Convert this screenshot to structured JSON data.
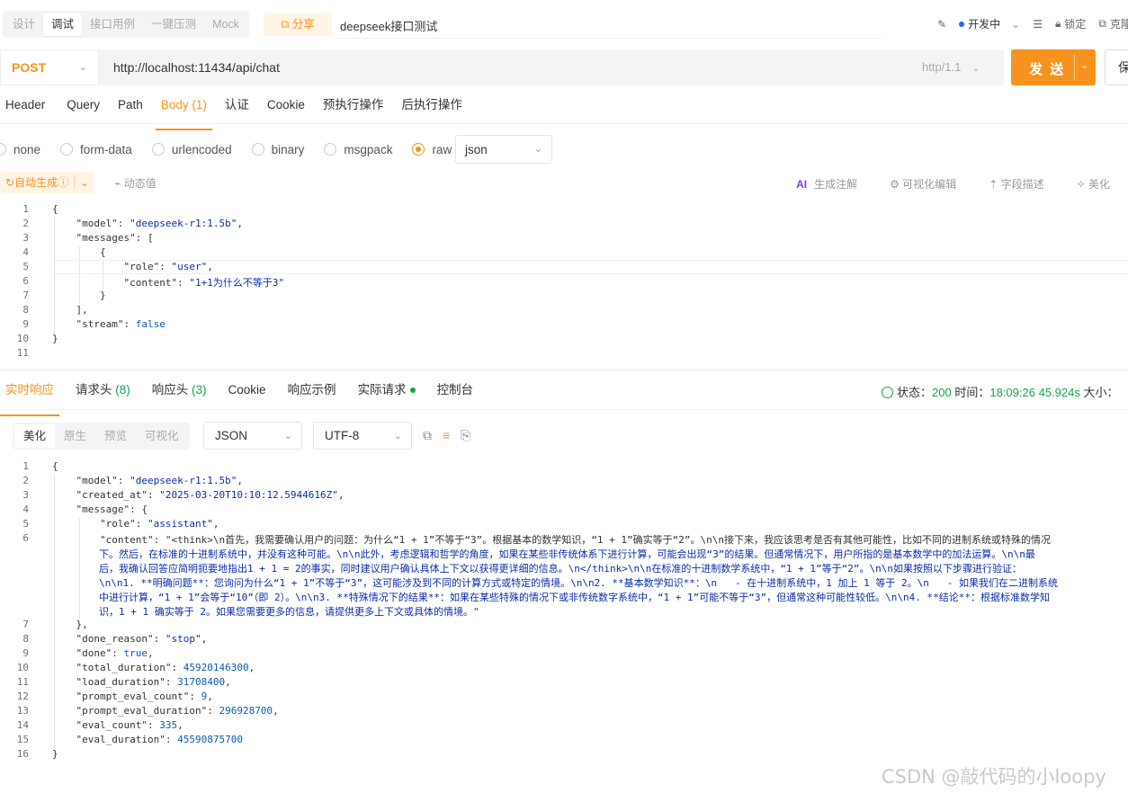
{
  "mode_tabs": [
    "设计",
    "调试",
    "接口用例",
    "一键压测",
    "Mock"
  ],
  "share_label": "分享",
  "api_name": "deepseek接口测试",
  "env": {
    "status": "开发中",
    "lock": "锁定",
    "clone": "克隆"
  },
  "request": {
    "method": "POST",
    "url": "http://localhost:11434/api/chat",
    "http_version": "http/1.1",
    "send_label": "发 送",
    "save_label": "保"
  },
  "req_tabs": [
    "Header",
    "Query",
    "Path",
    "Body (1)",
    "认证",
    "Cookie",
    "预执行操作",
    "后执行操作"
  ],
  "body_types": [
    "none",
    "form-data",
    "urlencoded",
    "binary",
    "msgpack",
    "raw"
  ],
  "body_format": "json",
  "autogen": {
    "label": "自动生成",
    "dynamic": "动态值"
  },
  "editor_tools": {
    "ai_mark": "AI",
    "gen_comment": "生成注解",
    "visual_edit": "可视化编辑",
    "field_desc": "字段描述",
    "beautify": "美化"
  },
  "request_body_lines": [
    "{",
    "    \"model\": \"deepseek-r1:1.5b\",",
    "    \"messages\": [",
    "        {",
    "            \"role\": \"user\",",
    "            \"content\": \"1+1为什么不等于3\"",
    "        }",
    "    ],",
    "    \"stream\": false",
    "}",
    ""
  ],
  "resp_tabs": {
    "realtime": "实时响应",
    "req_headers": "请求头",
    "req_headers_count": "(8)",
    "resp_headers": "响应头",
    "resp_headers_count": "(3)",
    "cookie": "Cookie",
    "example": "响应示例",
    "actual": "实际请求",
    "console": "控制台"
  },
  "status": {
    "status_label": "状态：",
    "code": "200",
    "time_label": "时间：",
    "time": "18:09:26",
    "duration": "45.924s",
    "size_label": "大小："
  },
  "view_modes": [
    "美化",
    "原生",
    "预览",
    "可视化"
  ],
  "resp_format": "JSON",
  "resp_encoding": "UTF-8",
  "response_lines": [
    "{",
    "    \"model\": \"deepseek-r1:1.5b\",",
    "    \"created_at\": \"2025-03-20T10:10:12.5944616Z\",",
    "    \"message\": {",
    "        \"role\": \"assistant\",",
    "        \"content\": \"<think>\\n首先，我需要确认用户的问题：为什么“1 + 1”不等于“3”。根据基本的数学知识，“1 + 1”确实等于“2”。\\n\\n接下来，我应该思考是否有其他可能性，比如不同的进制系统或特殊的情况",
    "    },",
    "    \"done_reason\": \"stop\",",
    "    \"done\": true,",
    "    \"total_duration\": 45920146300,",
    "    \"load_duration\": 31708400,",
    "    \"prompt_eval_count\": 9,",
    "    \"prompt_eval_duration\": 296928700,",
    "    \"eval_count\": 335,",
    "    \"eval_duration\": 45590875700",
    "}"
  ],
  "content_wrap_lines": [
    "下。然后，在标准的十进制系统中，并没有这种可能。\\n\\n此外，考虑逻辑和哲学的角度，如果在某些非传统体系下进行计算，可能会出现“3”的结果。但通常情况下，用户所指的是基本数学中的加法运算。\\n\\n最",
    "后，我确认回答应简明扼要地指出1 + 1 = 2的事实，同时建议用户确认具体上下文以获得更详细的信息。\\n</think>\\n\\n在标准的十进制数学系统中，“1 + 1”等于“2”。\\n\\n如果按照以下步骤进行验证：",
    "\\n\\n1. **明确问题**：您询问为什么“1 + 1”不等于“3”，这可能涉及到不同的计算方式或特定的情境。\\n\\n2. **基本数学知识**：\\n   - 在十进制系统中，1 加上 1 等于 2。\\n   - 如果我们在二进制系统",
    "中进行计算，“1 + 1”会等于“10”（即 2）。\\n\\n3. **特殊情况下的结果**：如果在某些特殊的情况下或非传统数字系统中，“1 + 1”可能不等于“3”，但通常这种可能性较低。\\n\\n4. **结论**：根据标准数学知",
    "识，1 + 1 确实等于 2。如果您需要更多的信息，请提供更多上下文或具体的情境。\""
  ],
  "watermark": "CSDN @敲代码的小loopy"
}
